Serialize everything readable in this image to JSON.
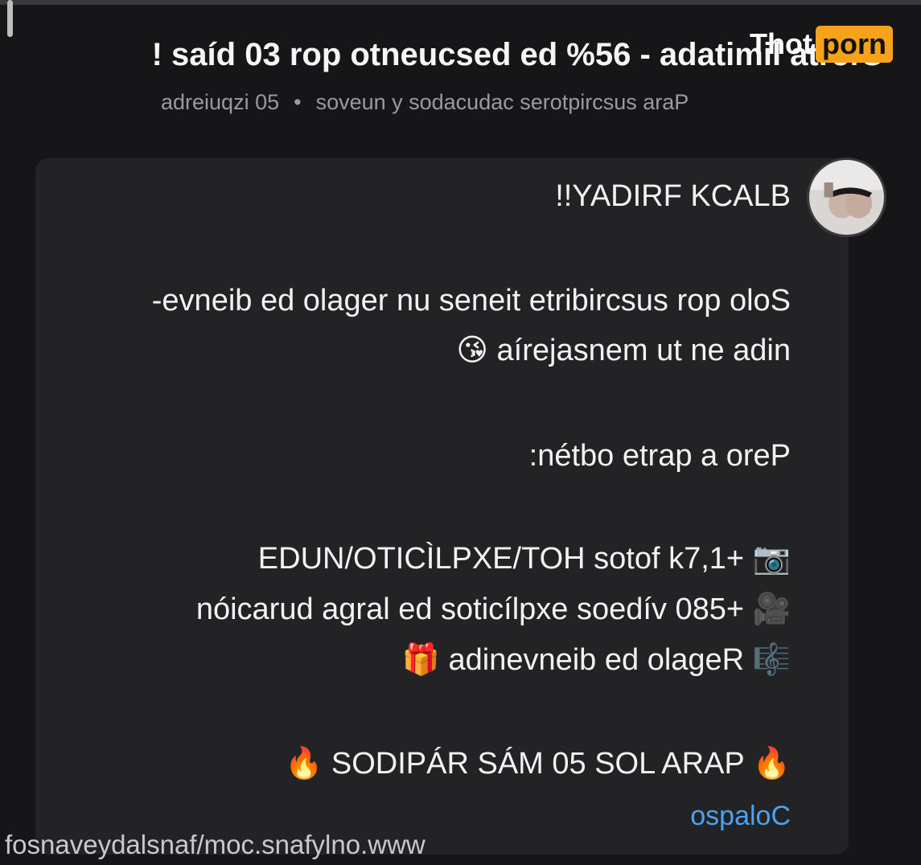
{
  "header": {
    "title": "Oferta limitada - 65% de descuento por 30 días !",
    "subtitle_audience": "Para suscriptores caducados y nuevos",
    "subtitle_separator": "•",
    "subtitle_remaining": "50 izquierda"
  },
  "watermark": {
    "part_a": "Thot",
    "part_b": "porn"
  },
  "message": {
    "line1": "BLACK FRIDAY!!",
    "line2": "Solo por suscribirte tienes un regalo de bienve-",
    "line3": "nida en tu mensajería",
    "line3_emoji": "😘",
    "line4": "Pero a parte obtén:",
    "item1_emoji": "📷",
    "item1": "+1,7k fotos HOT/EXPLÌCITO/NUDE",
    "item2_emoji": "🎥",
    "item2": "+580 vídeos explícitos de larga duración",
    "item3_emoji": "🎼",
    "item3": "Regalo de bienvenida",
    "item3_emoji_end": "🎁",
    "cta_emoji": "🔥",
    "cta": "PARA LOS 50 MÁS RÁPIDOS"
  },
  "collapse_label": "Colapso",
  "url_overlay": "www.onlyfans.com/fansladyevansof"
}
